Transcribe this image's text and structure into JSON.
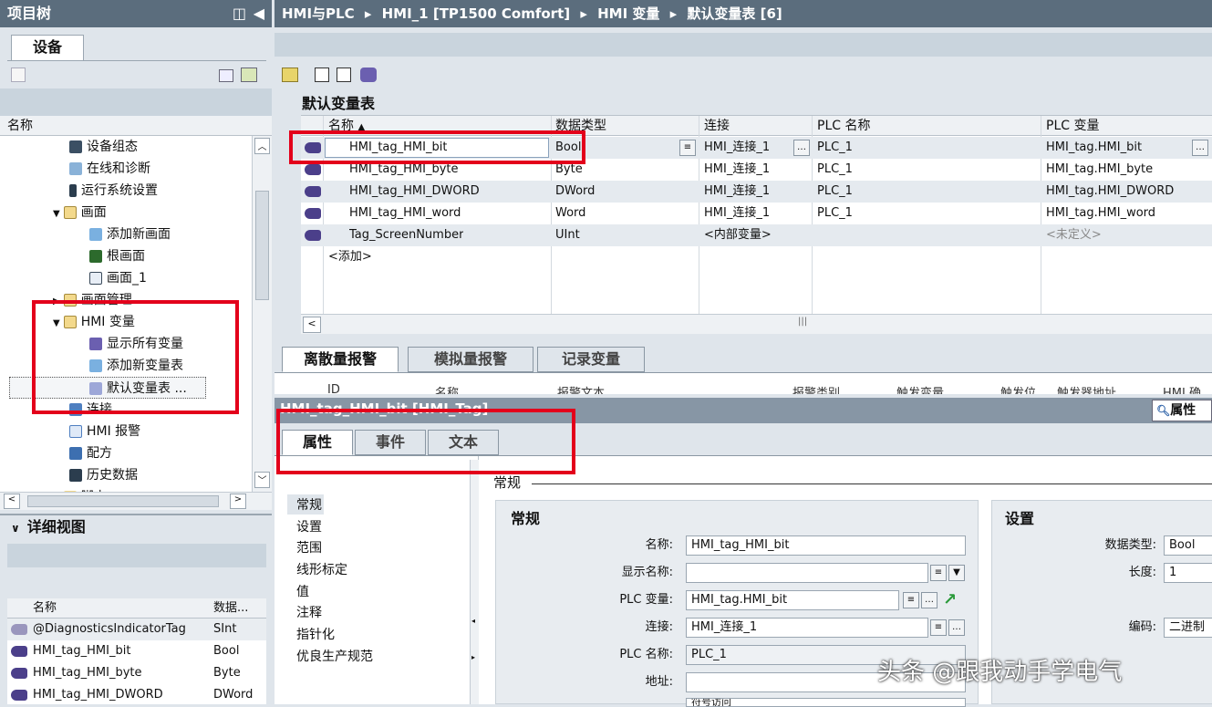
{
  "breadcrumb": {
    "p1": "HMI与PLC",
    "p2": "HMI_1 [TP1500 Comfort]",
    "p3": "HMI 变量",
    "p4": "默认变量表 [6]",
    "sep": "▸"
  },
  "project_tree": {
    "title": "项目树",
    "tab": "设备",
    "col_name": "名称",
    "items": [
      {
        "label": "设备组态",
        "icon": "device-config-icon"
      },
      {
        "label": "在线和诊断",
        "icon": "diagnostics-icon"
      },
      {
        "label": "运行系统设置",
        "icon": "runtime-settings-icon"
      },
      {
        "label": "画面",
        "icon": "folder-icon",
        "expanded": true
      },
      {
        "label": "添加新画面",
        "icon": "add-screen-icon"
      },
      {
        "label": "根画面",
        "icon": "screen-icon"
      },
      {
        "label": "画面_1",
        "icon": "screen-icon"
      },
      {
        "label": "画面管理",
        "icon": "folder-icon"
      },
      {
        "label": "HMI 变量",
        "icon": "folder-icon",
        "expanded": true
      },
      {
        "label": "显示所有变量",
        "icon": "tags-icon"
      },
      {
        "label": "添加新变量表",
        "icon": "add-table-icon"
      },
      {
        "label": "默认变量表 ...",
        "icon": "table-icon"
      },
      {
        "label": "连接",
        "icon": "connection-icon"
      },
      {
        "label": "HMI 报警",
        "icon": "alarm-icon"
      },
      {
        "label": "配方",
        "icon": "recipe-icon"
      },
      {
        "label": "历史数据",
        "icon": "history-icon"
      },
      {
        "label": "脚本",
        "icon": "folder-icon"
      }
    ]
  },
  "detail_view": {
    "title": "详细视图",
    "col_name": "名称",
    "col_type": "数据...",
    "rows": [
      {
        "name": "@DiagnosticsIndicatorTag",
        "type": "SInt"
      },
      {
        "name": "HMI_tag_HMI_bit",
        "type": "Bool"
      },
      {
        "name": "HMI_tag_HMI_byte",
        "type": "Byte"
      },
      {
        "name": "HMI_tag_HMI_DWORD",
        "type": "DWord"
      }
    ]
  },
  "tag_table": {
    "title": "默认变量表",
    "columns": {
      "name": "名称",
      "type": "数据类型",
      "conn": "连接",
      "plc_name": "PLC 名称",
      "plc_tag": "PLC 变量"
    },
    "rows": [
      {
        "name": "HMI_tag_HMI_bit",
        "type": "Bool",
        "conn": "HMI_连接_1",
        "plc_name": "PLC_1",
        "plc_tag": "HMI_tag.HMI_bit"
      },
      {
        "name": "HMI_tag_HMI_byte",
        "type": "Byte",
        "conn": "HMI_连接_1",
        "plc_name": "PLC_1",
        "plc_tag": "HMI_tag.HMI_byte"
      },
      {
        "name": "HMI_tag_HMI_DWORD",
        "type": "DWord",
        "conn": "HMI_连接_1",
        "plc_name": "PLC_1",
        "plc_tag": "HMI_tag.HMI_DWORD"
      },
      {
        "name": "HMI_tag_HMI_word",
        "type": "Word",
        "conn": "HMI_连接_1",
        "plc_name": "PLC_1",
        "plc_tag": "HMI_tag.HMI_word"
      },
      {
        "name": "Tag_ScreenNumber",
        "type": "UInt",
        "conn": "<内部变量>",
        "plc_name": "",
        "plc_tag": "<未定义>"
      }
    ],
    "add_row": "<添加>"
  },
  "alarm_tabs": [
    "离散量报警",
    "模拟量报警",
    "记录变量"
  ],
  "alarm_cols": [
    "ID",
    "名称",
    "报警文本",
    "报警类别",
    "触发变量",
    "触发位",
    "触发器地址",
    "HMI 确认"
  ],
  "inspector": {
    "title": "HMI_tag_HMI_bit [HMI_Tag]",
    "right_label": "属性",
    "tabs": [
      "属性",
      "事件",
      "文本"
    ],
    "nav": [
      "常规",
      "设置",
      "范围",
      "线形标定",
      "值",
      "注释",
      "指针化",
      "优良生产规范"
    ],
    "section_header": "常规",
    "general": {
      "title": "常规",
      "name_label": "名称:",
      "name_value": "HMI_tag_HMI_bit",
      "display_label": "显示名称:",
      "display_value": "",
      "plc_tag_label": "PLC 变量:",
      "plc_tag_value": "HMI_tag.HMI_bit",
      "conn_label": "连接:",
      "conn_value": "HMI_连接_1",
      "plc_name_label": "PLC 名称:",
      "plc_name_value": "PLC_1",
      "addr_label": "地址:",
      "addr_value": "",
      "access_value": "符号访问"
    },
    "settings": {
      "title": "设置",
      "type_label": "数据类型:",
      "type_value": "Bool",
      "len_label": "长度:",
      "len_value": "1",
      "enc_label": "编码:",
      "enc_value": "二进制"
    }
  },
  "watermark": "头条 @跟我动手学电气",
  "colors": {
    "highlight": "#e3001b",
    "header": "#5b6d7d",
    "tag_icon": "#4b3f8a"
  }
}
